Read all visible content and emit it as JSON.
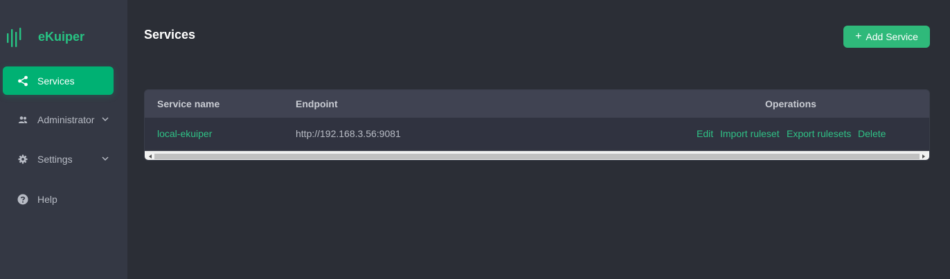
{
  "app": {
    "name": "eKuiper",
    "brand_color": "#27c383"
  },
  "sidebar": {
    "items": [
      {
        "label": "Services",
        "icon": "share-icon",
        "active": true
      },
      {
        "label": "Administrator",
        "icon": "users-icon",
        "expandable": true
      },
      {
        "label": "Settings",
        "icon": "gear-icon",
        "expandable": true
      },
      {
        "label": "Help",
        "icon": "help-icon"
      }
    ]
  },
  "header": {
    "title": "Services",
    "add_button": "Add Service"
  },
  "table": {
    "columns": [
      "Service name",
      "Endpoint",
      "Operations"
    ],
    "rows": [
      {
        "name": "local-ekuiper",
        "endpoint": "http://192.168.3.56:9081",
        "operations": [
          "Edit",
          "Import ruleset",
          "Export rulesets",
          "Delete"
        ]
      }
    ]
  }
}
